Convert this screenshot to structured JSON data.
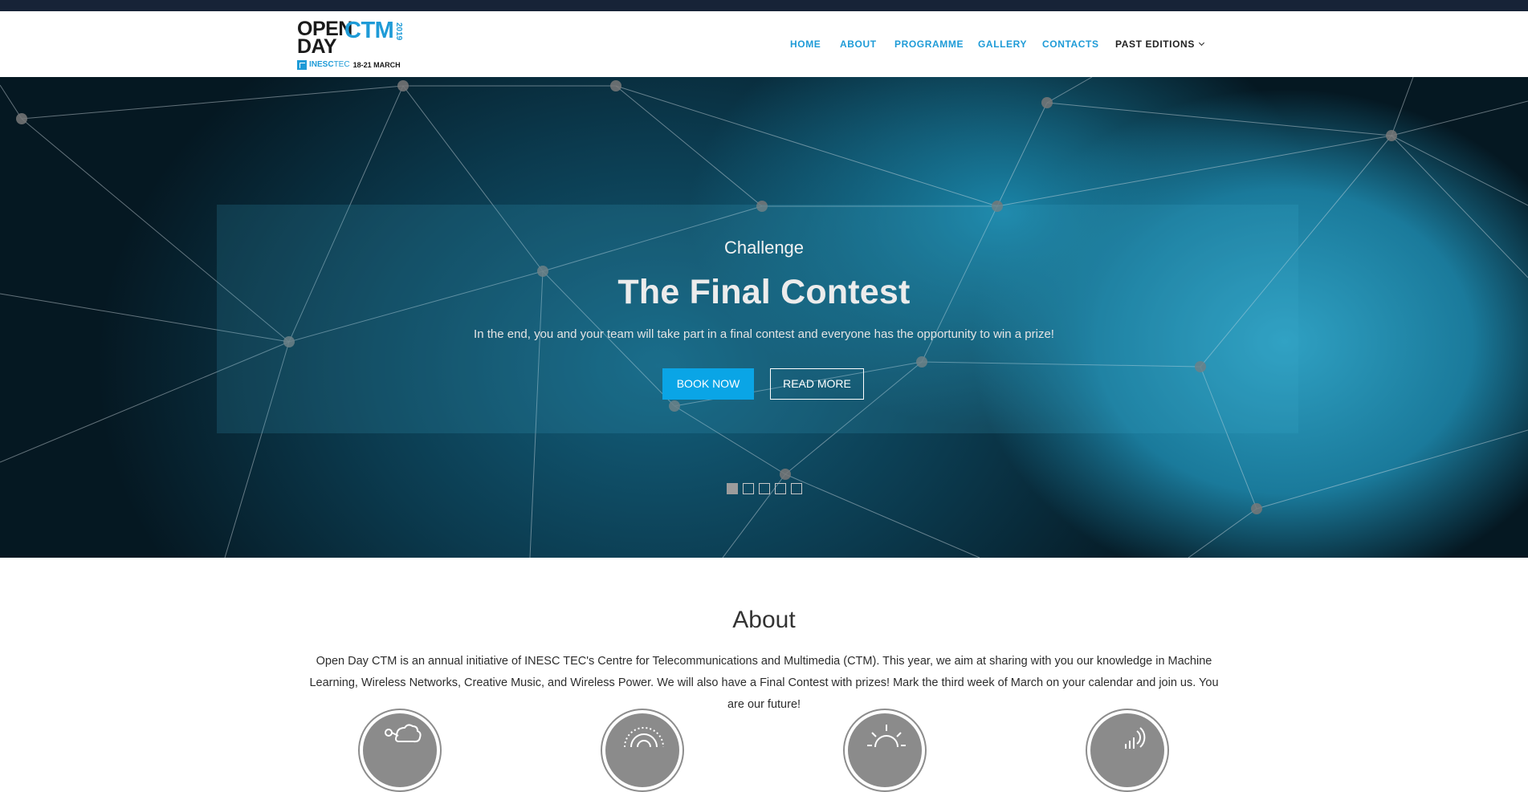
{
  "logo": {
    "open": "OPEN",
    "day": "DAY",
    "ctm": "CTM",
    "year": "2019",
    "inesc": "INESC",
    "tec": "TEC",
    "dates": "18-21 MARCH"
  },
  "nav": {
    "items": [
      {
        "label": "HOME"
      },
      {
        "label": "ABOUT"
      },
      {
        "label": "PROGRAMME"
      },
      {
        "label": "GALLERY"
      },
      {
        "label": "CONTACTS"
      },
      {
        "label": "PAST EDITIONS"
      }
    ]
  },
  "hero": {
    "subtitle": "Challenge",
    "title": "The Final Contest",
    "description": "In the end, you and your team will take part in a final contest and everyone has the opportunity to win a prize!",
    "book_label": "BOOK NOW",
    "read_label": "READ MORE",
    "slides": {
      "count": 5,
      "active_index": 0
    }
  },
  "about": {
    "title": "About",
    "text": "Open Day CTM is an annual initiative of INESC TEC's Centre for Telecommunications and Multimedia (CTM). This year, we aim at sharing with you our knowledge in Machine Learning, Wireless Networks, Creative Music, and Wireless Power. We will also have a Final Contest with prizes! Mark the third week of March on your calendar and join us. You are our future!"
  },
  "features": [
    {
      "icon": "machine-learning-icon"
    },
    {
      "icon": "wireless-networks-icon"
    },
    {
      "icon": "creative-music-icon"
    },
    {
      "icon": "wireless-power-icon"
    }
  ],
  "colors": {
    "accent": "#1e9bd7",
    "button": "#0aa5e6",
    "topbar": "#172337",
    "hero_tint": "#13607d"
  }
}
